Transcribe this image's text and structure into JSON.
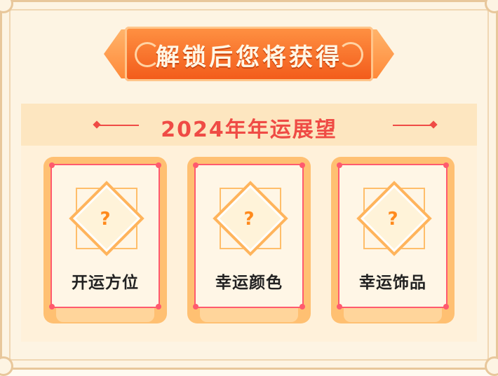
{
  "banner": {
    "title": "解锁后您将获得"
  },
  "section": {
    "title": "2024年年运展望"
  },
  "cards": [
    {
      "icon": "?",
      "label": "开运方位"
    },
    {
      "icon": "?",
      "label": "幸运颜色"
    },
    {
      "icon": "?",
      "label": "幸运饰品"
    }
  ],
  "colors": {
    "accent": "#ef4b45",
    "orange": "#ff8a3a",
    "card": "#ffc072"
  }
}
